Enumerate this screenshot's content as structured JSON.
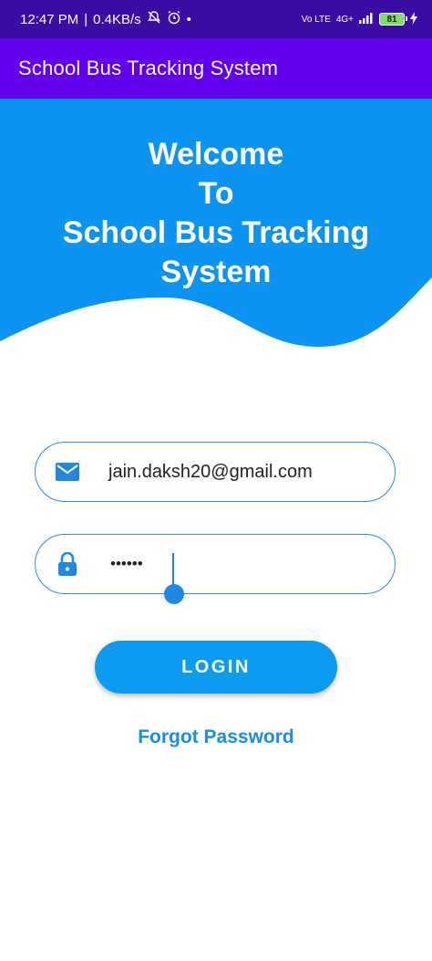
{
  "status_bar": {
    "time": "12:47 PM",
    "separator": "|",
    "network_speed": "0.4KB/s",
    "network_type": "4G+",
    "volte": "Vo LTE",
    "battery": "81"
  },
  "app_bar": {
    "title": "School Bus Tracking System"
  },
  "hero": {
    "title": "Welcome\nTo\nSchool Bus Tracking\nSystem"
  },
  "form": {
    "email_value": "jain.daksh20@gmail.com",
    "password_value": "••••••"
  },
  "login_label": "LOGIN",
  "forgot_label": "Forgot Password",
  "colors": {
    "status_bar": "#3a0ca3",
    "app_bar": "#6200ee",
    "hero": "#0a93f0",
    "accent": "#0d9bf2"
  }
}
